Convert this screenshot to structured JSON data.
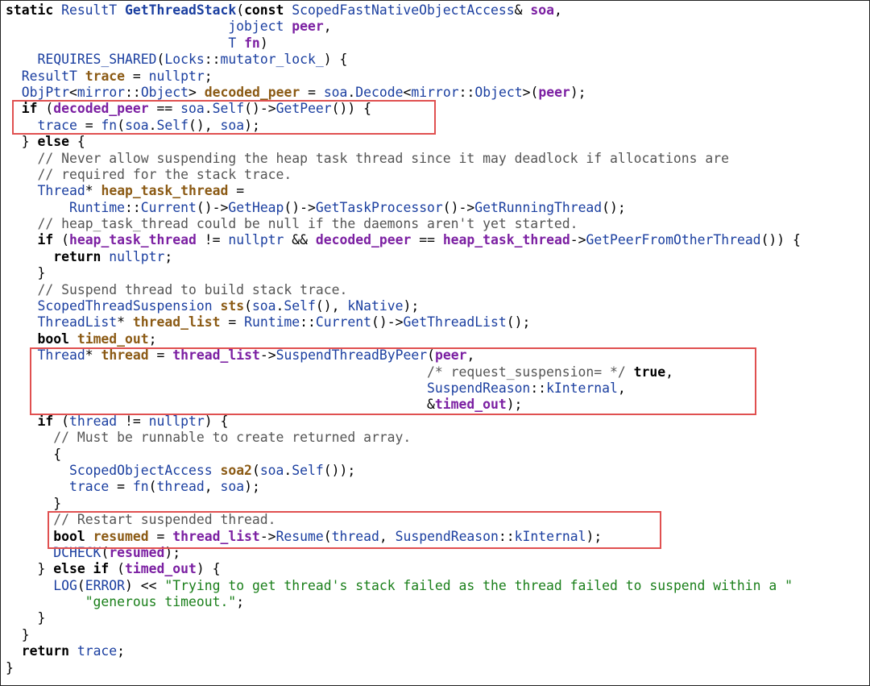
{
  "code": {
    "lines": [
      [
        [
          "kw",
          "static "
        ],
        [
          "ty",
          "ResultT "
        ],
        [
          "fn-def",
          "GetThreadStack"
        ],
        [
          "pl",
          "("
        ],
        [
          "kw",
          "const "
        ],
        [
          "ty",
          "ScopedFastNativeObjectAccess"
        ],
        [
          "pl",
          "& "
        ],
        [
          "field",
          "soa"
        ],
        [
          "pl",
          ","
        ]
      ],
      [
        [
          "pl",
          "                            "
        ],
        [
          "ty",
          "jobject "
        ],
        [
          "field",
          "peer"
        ],
        [
          "pl",
          ","
        ]
      ],
      [
        [
          "pl",
          "                            "
        ],
        [
          "ty",
          "T "
        ],
        [
          "field",
          "fn"
        ],
        [
          "pl",
          ")"
        ]
      ],
      [
        [
          "pl",
          "    "
        ],
        [
          "fn",
          "REQUIRES_SHARED"
        ],
        [
          "pl",
          "("
        ],
        [
          "ty",
          "Locks"
        ],
        [
          "pl",
          "::"
        ],
        [
          "ty",
          "mutator_lock_"
        ],
        [
          "pl",
          ") {"
        ]
      ],
      [
        [
          "pl",
          "  "
        ],
        [
          "ty",
          "ResultT "
        ],
        [
          "var",
          "trace"
        ],
        [
          "pl",
          " = "
        ],
        [
          "ty",
          "nullptr"
        ],
        [
          "pl",
          ";"
        ]
      ],
      [
        [
          "pl",
          "  "
        ],
        [
          "ty",
          "ObjPtr"
        ],
        [
          "pl",
          "<"
        ],
        [
          "ty",
          "mirror"
        ],
        [
          "pl",
          "::"
        ],
        [
          "ty",
          "Object"
        ],
        [
          "pl",
          "> "
        ],
        [
          "var",
          "decoded_peer"
        ],
        [
          "pl",
          " = "
        ],
        [
          "fn",
          "soa"
        ],
        [
          "pl",
          "."
        ],
        [
          "fn",
          "Decode"
        ],
        [
          "pl",
          "<"
        ],
        [
          "ty",
          "mirror"
        ],
        [
          "pl",
          "::"
        ],
        [
          "ty",
          "Object"
        ],
        [
          "pl",
          ">("
        ],
        [
          "field",
          "peer"
        ],
        [
          "pl",
          ");"
        ]
      ],
      [
        [
          "pl",
          "  "
        ],
        [
          "kw",
          "if "
        ],
        [
          "pl",
          "("
        ],
        [
          "field",
          "decoded_peer"
        ],
        [
          "pl",
          " == "
        ],
        [
          "fn",
          "soa"
        ],
        [
          "pl",
          "."
        ],
        [
          "fn",
          "Self"
        ],
        [
          "pl",
          "()->"
        ],
        [
          "fn",
          "GetPeer"
        ],
        [
          "pl",
          "()) {"
        ]
      ],
      [
        [
          "pl",
          "    "
        ],
        [
          "fn",
          "trace"
        ],
        [
          "pl",
          " = "
        ],
        [
          "fn",
          "fn"
        ],
        [
          "pl",
          "("
        ],
        [
          "fn",
          "soa"
        ],
        [
          "pl",
          "."
        ],
        [
          "fn",
          "Self"
        ],
        [
          "pl",
          "(), "
        ],
        [
          "fn",
          "soa"
        ],
        [
          "pl",
          ");"
        ]
      ],
      [
        [
          "pl",
          "  } "
        ],
        [
          "kw",
          "else "
        ],
        [
          "pl",
          "{"
        ]
      ],
      [
        [
          "pl",
          "    "
        ],
        [
          "cm",
          "// Never allow suspending the heap task thread since it may deadlock if allocations are"
        ]
      ],
      [
        [
          "pl",
          "    "
        ],
        [
          "cm",
          "// required for the stack trace."
        ]
      ],
      [
        [
          "pl",
          "    "
        ],
        [
          "ty",
          "Thread"
        ],
        [
          "pl",
          "* "
        ],
        [
          "var",
          "heap_task_thread"
        ],
        [
          "pl",
          " ="
        ]
      ],
      [
        [
          "pl",
          "        "
        ],
        [
          "ty",
          "Runtime"
        ],
        [
          "pl",
          "::"
        ],
        [
          "fn",
          "Current"
        ],
        [
          "pl",
          "()->"
        ],
        [
          "fn",
          "GetHeap"
        ],
        [
          "pl",
          "()->"
        ],
        [
          "fn",
          "GetTaskProcessor"
        ],
        [
          "pl",
          "()->"
        ],
        [
          "fn",
          "GetRunningThread"
        ],
        [
          "pl",
          "();"
        ]
      ],
      [
        [
          "pl",
          "    "
        ],
        [
          "cm",
          "// heap_task_thread could be null if the daemons aren't yet started."
        ]
      ],
      [
        [
          "pl",
          "    "
        ],
        [
          "kw",
          "if "
        ],
        [
          "pl",
          "("
        ],
        [
          "field",
          "heap_task_thread"
        ],
        [
          "pl",
          " != "
        ],
        [
          "ty",
          "nullptr"
        ],
        [
          "pl",
          " && "
        ],
        [
          "field",
          "decoded_peer"
        ],
        [
          "pl",
          " == "
        ],
        [
          "field",
          "heap_task_thread"
        ],
        [
          "pl",
          "->"
        ],
        [
          "fn",
          "GetPeerFromOtherThread"
        ],
        [
          "pl",
          "()) {"
        ]
      ],
      [
        [
          "pl",
          "      "
        ],
        [
          "kw",
          "return "
        ],
        [
          "ty",
          "nullptr"
        ],
        [
          "pl",
          ";"
        ]
      ],
      [
        [
          "pl",
          "    }"
        ]
      ],
      [
        [
          "pl",
          "    "
        ],
        [
          "cm",
          "// Suspend thread to build stack trace."
        ]
      ],
      [
        [
          "pl",
          "    "
        ],
        [
          "ty",
          "ScopedThreadSuspension "
        ],
        [
          "var",
          "sts"
        ],
        [
          "pl",
          "("
        ],
        [
          "fn",
          "soa"
        ],
        [
          "pl",
          "."
        ],
        [
          "fn",
          "Self"
        ],
        [
          "pl",
          "(), "
        ],
        [
          "ty",
          "kNative"
        ],
        [
          "pl",
          ");"
        ]
      ],
      [
        [
          "pl",
          "    "
        ],
        [
          "ty",
          "ThreadList"
        ],
        [
          "pl",
          "* "
        ],
        [
          "var",
          "thread_list"
        ],
        [
          "pl",
          " = "
        ],
        [
          "ty",
          "Runtime"
        ],
        [
          "pl",
          "::"
        ],
        [
          "fn",
          "Current"
        ],
        [
          "pl",
          "()->"
        ],
        [
          "fn",
          "GetThreadList"
        ],
        [
          "pl",
          "();"
        ]
      ],
      [
        [
          "pl",
          "    "
        ],
        [
          "kw",
          "bool "
        ],
        [
          "var",
          "timed_out"
        ],
        [
          "pl",
          ";"
        ]
      ],
      [
        [
          "pl",
          "    "
        ],
        [
          "ty",
          "Thread"
        ],
        [
          "pl",
          "* "
        ],
        [
          "var",
          "thread"
        ],
        [
          "pl",
          " = "
        ],
        [
          "field",
          "thread_list"
        ],
        [
          "pl",
          "->"
        ],
        [
          "fn",
          "SuspendThreadByPeer"
        ],
        [
          "pl",
          "("
        ],
        [
          "field",
          "peer"
        ],
        [
          "pl",
          ","
        ]
      ],
      [
        [
          "pl",
          "                                                     "
        ],
        [
          "cm",
          "/* request_suspension= */ "
        ],
        [
          "kw",
          "true"
        ],
        [
          "pl",
          ","
        ]
      ],
      [
        [
          "pl",
          "                                                     "
        ],
        [
          "ty",
          "SuspendReason"
        ],
        [
          "pl",
          "::"
        ],
        [
          "ty",
          "kInternal"
        ],
        [
          "pl",
          ","
        ]
      ],
      [
        [
          "pl",
          "                                                     &"
        ],
        [
          "field",
          "timed_out"
        ],
        [
          "pl",
          ");"
        ]
      ],
      [
        [
          "pl",
          "    "
        ],
        [
          "kw",
          "if "
        ],
        [
          "pl",
          "("
        ],
        [
          "fn",
          "thread"
        ],
        [
          "pl",
          " != "
        ],
        [
          "ty",
          "nullptr"
        ],
        [
          "pl",
          ") {"
        ]
      ],
      [
        [
          "pl",
          "      "
        ],
        [
          "cm",
          "// Must be runnable to create returned array."
        ]
      ],
      [
        [
          "pl",
          "      {"
        ]
      ],
      [
        [
          "pl",
          "        "
        ],
        [
          "ty",
          "ScopedObjectAccess "
        ],
        [
          "var",
          "soa2"
        ],
        [
          "pl",
          "("
        ],
        [
          "fn",
          "soa"
        ],
        [
          "pl",
          "."
        ],
        [
          "fn",
          "Self"
        ],
        [
          "pl",
          "());"
        ]
      ],
      [
        [
          "pl",
          "        "
        ],
        [
          "fn",
          "trace"
        ],
        [
          "pl",
          " = "
        ],
        [
          "fn",
          "fn"
        ],
        [
          "pl",
          "("
        ],
        [
          "fn",
          "thread"
        ],
        [
          "pl",
          ", "
        ],
        [
          "fn",
          "soa"
        ],
        [
          "pl",
          ");"
        ]
      ],
      [
        [
          "pl",
          "      }"
        ]
      ],
      [
        [
          "pl",
          "      "
        ],
        [
          "cm",
          "// Restart suspended thread."
        ]
      ],
      [
        [
          "pl",
          "      "
        ],
        [
          "kw",
          "bool "
        ],
        [
          "var",
          "resumed"
        ],
        [
          "pl",
          " = "
        ],
        [
          "field",
          "thread_list"
        ],
        [
          "pl",
          "->"
        ],
        [
          "fn",
          "Resume"
        ],
        [
          "pl",
          "("
        ],
        [
          "fn",
          "thread"
        ],
        [
          "pl",
          ", "
        ],
        [
          "ty",
          "SuspendReason"
        ],
        [
          "pl",
          "::"
        ],
        [
          "ty",
          "kInternal"
        ],
        [
          "pl",
          ");"
        ]
      ],
      [
        [
          "pl",
          "      "
        ],
        [
          "fn",
          "DCHECK"
        ],
        [
          "pl",
          "("
        ],
        [
          "field",
          "resumed"
        ],
        [
          "pl",
          ");"
        ]
      ],
      [
        [
          "pl",
          "    } "
        ],
        [
          "kw",
          "else if "
        ],
        [
          "pl",
          "("
        ],
        [
          "field",
          "timed_out"
        ],
        [
          "pl",
          ") {"
        ]
      ],
      [
        [
          "pl",
          "      "
        ],
        [
          "fn",
          "LOG"
        ],
        [
          "pl",
          "("
        ],
        [
          "ty",
          "ERROR"
        ],
        [
          "pl",
          ") << "
        ],
        [
          "st",
          "\"Trying to get thread's stack failed as the thread failed to suspend within a \""
        ]
      ],
      [
        [
          "pl",
          "          "
        ],
        [
          "st",
          "\"generous timeout.\""
        ],
        [
          "pl",
          ";"
        ]
      ],
      [
        [
          "pl",
          "    }"
        ]
      ],
      [
        [
          "pl",
          "  }"
        ]
      ],
      [
        [
          "pl",
          "  "
        ],
        [
          "kw",
          "return "
        ],
        [
          "fn",
          "trace"
        ],
        [
          "pl",
          ";"
        ]
      ],
      [
        [
          "pl",
          "}"
        ]
      ]
    ]
  },
  "colors": {
    "keyword": "#000000",
    "type": "#1b3fa0",
    "variable": "#8b5a14",
    "field": "#7b1fa2",
    "comment": "#555555",
    "string": "#1a7f1a",
    "highlight_border": "#e05050"
  }
}
